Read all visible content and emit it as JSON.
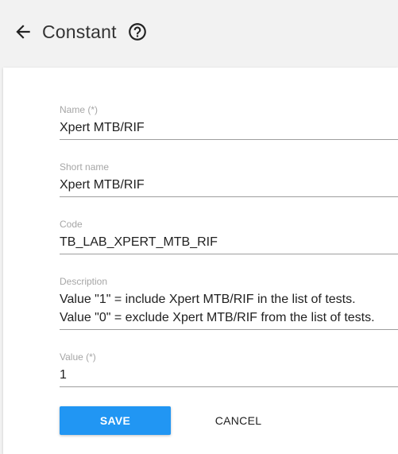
{
  "header": {
    "back_icon": "arrow-left-icon",
    "title": "Constant",
    "help_icon": "help-circle-icon"
  },
  "form": {
    "fields": [
      {
        "label": "Name (*)",
        "value": "Xpert MTB/RIF"
      },
      {
        "label": "Short name",
        "value": "Xpert MTB/RIF"
      },
      {
        "label": "Code",
        "value": "TB_LAB_XPERT_MTB_RIF"
      },
      {
        "label": "Description",
        "value": "Value \"1\" = include Xpert MTB/RIF in the list of tests.\nValue \"0\" = exclude Xpert MTB/RIF from the list of tests."
      },
      {
        "label": "Value (*)",
        "value": "1"
      }
    ],
    "save_label": "SAVE",
    "cancel_label": "CANCEL"
  },
  "colors": {
    "accent": "#2196f3",
    "background": "#f2f2f2",
    "card": "#ffffff",
    "label": "#a6a6a6",
    "underline": "#9e9e9e"
  }
}
